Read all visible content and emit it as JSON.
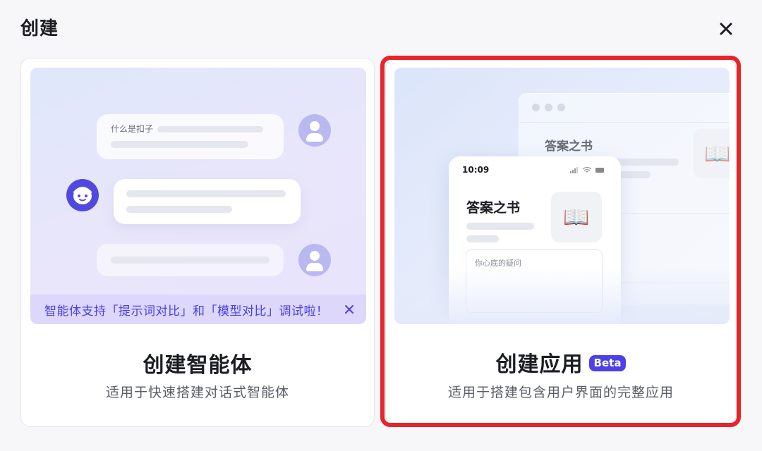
{
  "dialog": {
    "title": "创建",
    "close_icon": "close-icon"
  },
  "cards": {
    "agent": {
      "title": "创建智能体",
      "description": "适用于快速搭建对话式智能体",
      "preview": {
        "question_text": "什么是扣子",
        "tip_text": "智能体支持「提示词对比」和「模型对比」调试啦！",
        "tip_close_icon": "close-icon"
      }
    },
    "app": {
      "title": "创建应用",
      "badge": "Beta",
      "description": "适用于搭建包含用户界面的完整应用",
      "selected": true,
      "preview": {
        "window_title": "答案之书",
        "phone_time": "10:09",
        "phone_title": "答案之书",
        "book_emoji": "📖",
        "input_placeholder": "你心底的疑问"
      }
    }
  },
  "colors": {
    "accent": "#4e40e5",
    "highlight": "#e8242a",
    "tip_bg": "#dcd7fb"
  }
}
